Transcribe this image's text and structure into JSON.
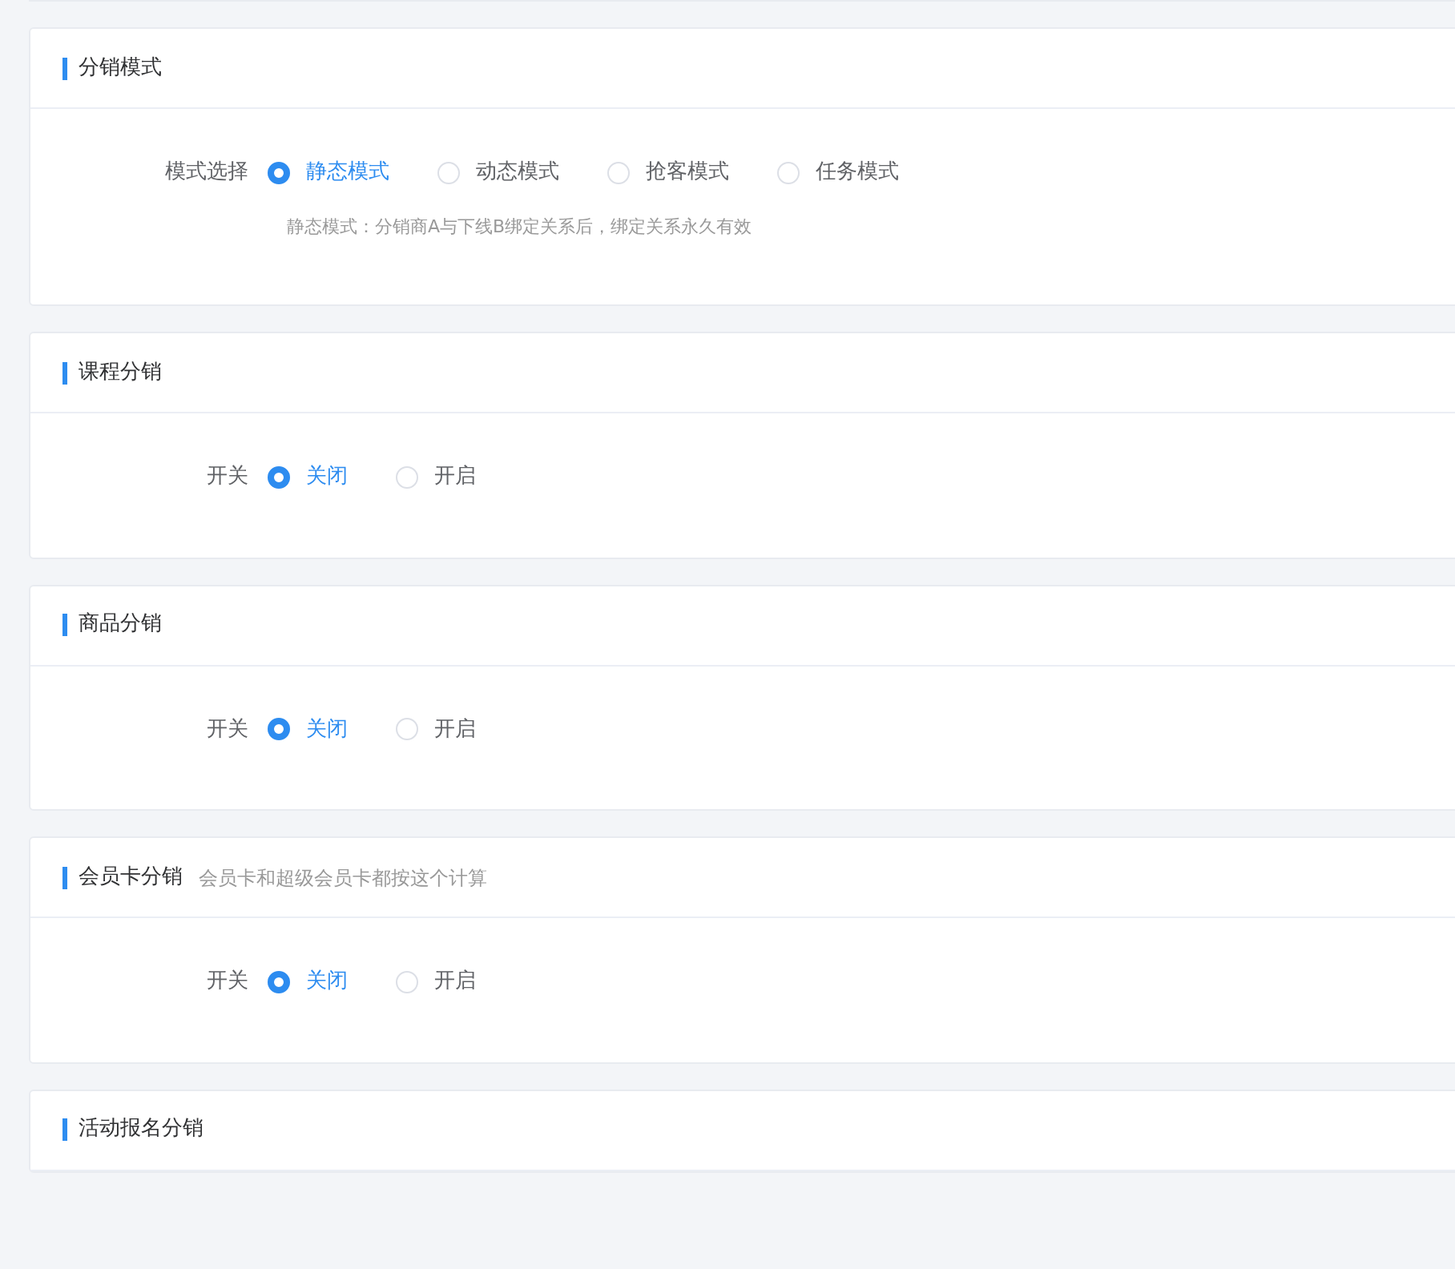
{
  "sections": [
    {
      "title": "分销模式",
      "field": {
        "label": "模式选择",
        "options": [
          {
            "label": "静态模式",
            "selected": true
          },
          {
            "label": "动态模式",
            "selected": false
          },
          {
            "label": "抢客模式",
            "selected": false
          },
          {
            "label": "任务模式",
            "selected": false
          }
        ],
        "hint": "静态模式：分销商A与下线B绑定关系后，绑定关系永久有效"
      }
    },
    {
      "title": "课程分销",
      "field": {
        "label": "开关",
        "options": [
          {
            "label": "关闭",
            "selected": true
          },
          {
            "label": "开启",
            "selected": false
          }
        ]
      }
    },
    {
      "title": "商品分销",
      "field": {
        "label": "开关",
        "options": [
          {
            "label": "关闭",
            "selected": true
          },
          {
            "label": "开启",
            "selected": false
          }
        ]
      }
    },
    {
      "title": "会员卡分销",
      "note": "会员卡和超级会员卡都按这个计算",
      "field": {
        "label": "开关",
        "options": [
          {
            "label": "关闭",
            "selected": true
          },
          {
            "label": "开启",
            "selected": false
          }
        ]
      }
    },
    {
      "title": "活动报名分销"
    }
  ]
}
